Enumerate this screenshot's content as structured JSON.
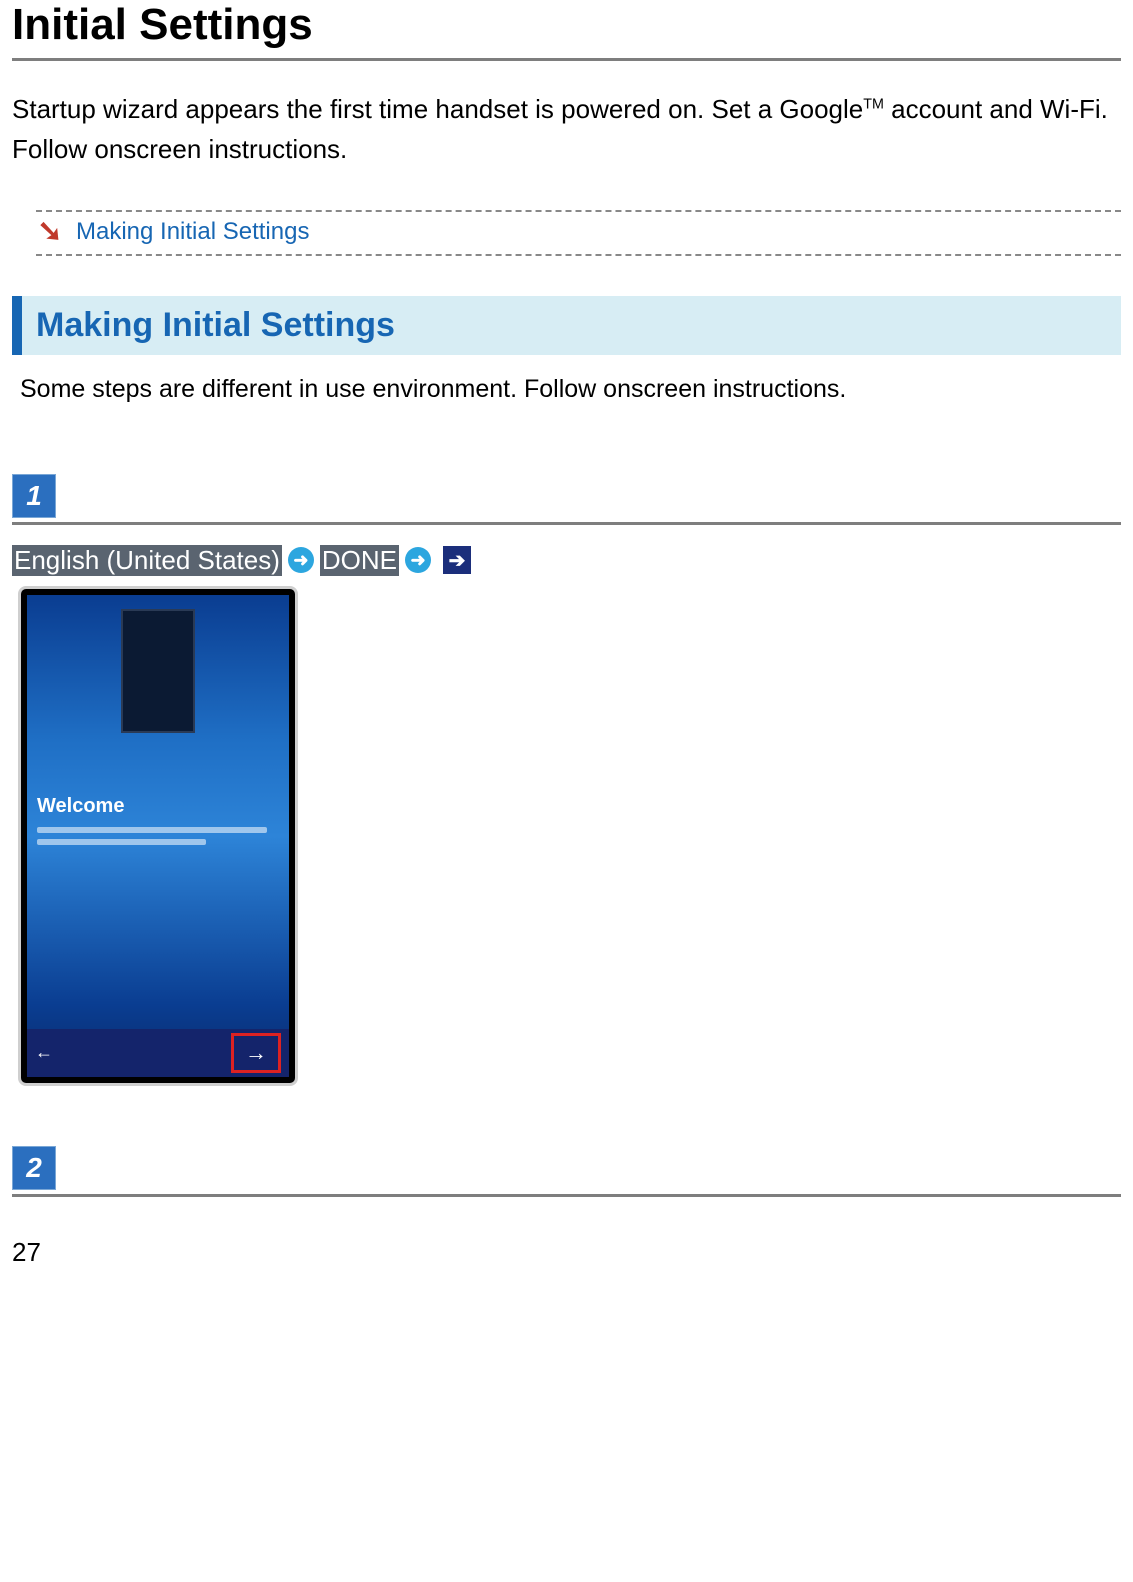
{
  "title": "Initial Settings",
  "intro_pre": "Startup wizard appears the first time handset is powered on. Set a Google",
  "intro_tm": "TM",
  "intro_post": " account and Wi-Fi. Follow onscreen instructions.",
  "toc": {
    "link_text": "Making Initial Settings"
  },
  "section": {
    "heading": "Making Initial Settings",
    "intro": "Some steps are different in use environment. Follow onscreen instructions."
  },
  "steps": {
    "step1": {
      "number": "1",
      "language_label": "English (United States)",
      "done_label": "DONE"
    },
    "step2": {
      "number": "2"
    }
  },
  "phone": {
    "welcome": "Welcome",
    "back_glyph": "←",
    "next_glyph": "→"
  },
  "page_number": "27"
}
